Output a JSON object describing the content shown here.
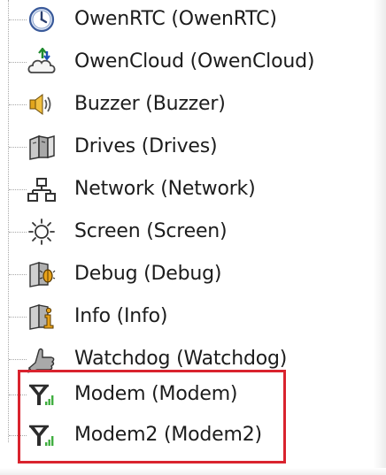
{
  "tree": {
    "items": [
      {
        "label": "OwenRTC (OwenRTC)",
        "icon": "clock-icon"
      },
      {
        "label": "OwenCloud (OwenCloud)",
        "icon": "cloud-upload-icon"
      },
      {
        "label": "Buzzer (Buzzer)",
        "icon": "speaker-icon"
      },
      {
        "label": "Drives (Drives)",
        "icon": "drives-icon"
      },
      {
        "label": "Network (Network)",
        "icon": "network-icon"
      },
      {
        "label": "Screen (Screen)",
        "icon": "sun-icon"
      },
      {
        "label": "Debug (Debug)",
        "icon": "debug-icon"
      },
      {
        "label": "Info (Info)",
        "icon": "info-icon"
      },
      {
        "label": "Watchdog (Watchdog)",
        "icon": "watchdog-hand-icon"
      },
      {
        "label": "Modem (Modem)",
        "icon": "antenna-signal-icon"
      },
      {
        "label": "Modem2 (Modem2)",
        "icon": "antenna-signal-icon"
      }
    ]
  },
  "highlight": {
    "color": "#d9232e",
    "items": [
      "Modem (Modem)",
      "Modem2 (Modem2)"
    ]
  }
}
